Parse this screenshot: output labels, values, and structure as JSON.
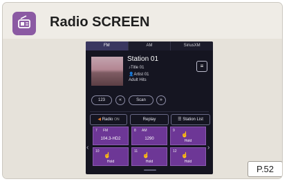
{
  "title": "Radio SCREEN",
  "page_ref": "P.52",
  "screen": {
    "tabs": [
      {
        "label": "FM",
        "active": true
      },
      {
        "label": "AM",
        "active": false
      },
      {
        "label": "SiriusXM",
        "active": false
      }
    ],
    "station": "Station 01",
    "title_line": "Title 01",
    "artist_line": "Artist 01",
    "genre": "Adult Hits",
    "controls": {
      "direct": "123",
      "scan": "Scan"
    },
    "source": {
      "radio_label": "Radio",
      "radio_state": "ON",
      "replay": "Replay",
      "station_list": "Station List"
    },
    "presets": [
      {
        "num": "7",
        "band": "FM",
        "freq": "104.3-HD2"
      },
      {
        "num": "8",
        "band": "AM",
        "freq": "1290"
      },
      {
        "num": "9",
        "band": "",
        "freq": "Hold"
      },
      {
        "num": "10",
        "band": "",
        "freq": "Hold"
      },
      {
        "num": "11",
        "band": "",
        "freq": "Hold"
      },
      {
        "num": "12",
        "band": "",
        "freq": "Hold"
      }
    ]
  }
}
